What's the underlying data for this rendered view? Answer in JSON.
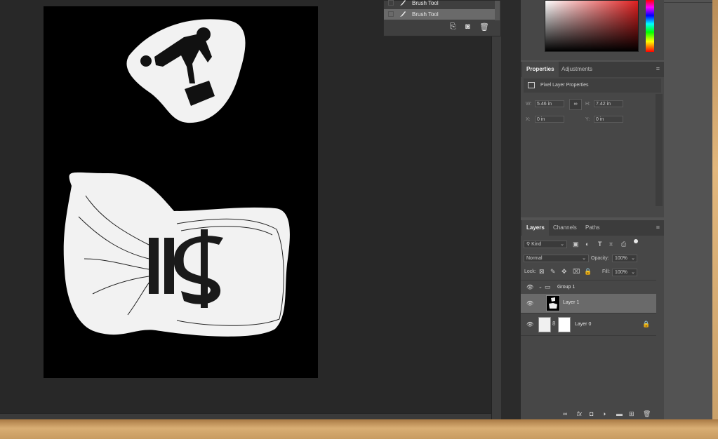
{
  "history": {
    "rows": [
      {
        "label": "Brush Tool",
        "selected": false
      },
      {
        "label": "Brush Tool",
        "selected": true
      }
    ]
  },
  "properties": {
    "tabs": [
      "Properties",
      "Adjustments"
    ],
    "header": "Pixel Layer Properties",
    "w_label": "W:",
    "w_value": "5.46 in",
    "h_label": "H:",
    "h_value": "7.42 in",
    "x_label": "X:",
    "x_value": "0 in",
    "y_label": "Y:",
    "y_value": "0 in"
  },
  "layers": {
    "tabs": [
      "Layers",
      "Channels",
      "Paths"
    ],
    "filter_kind": "Kind",
    "blend_mode": "Normal",
    "opacity_label": "Opacity:",
    "opacity_value": "100%",
    "lock_label": "Lock:",
    "fill_label": "Fill:",
    "fill_value": "100%",
    "items": [
      {
        "name": "Group 1",
        "type": "group"
      },
      {
        "name": "Layer 1",
        "type": "pixel",
        "selected": true
      },
      {
        "name": "Layer 0",
        "type": "pixel-mask",
        "locked": true
      }
    ]
  },
  "colors": {
    "accent_selection": "#6a6a6a",
    "canvas_bg": "#282828",
    "panel_bg": "#474747"
  }
}
